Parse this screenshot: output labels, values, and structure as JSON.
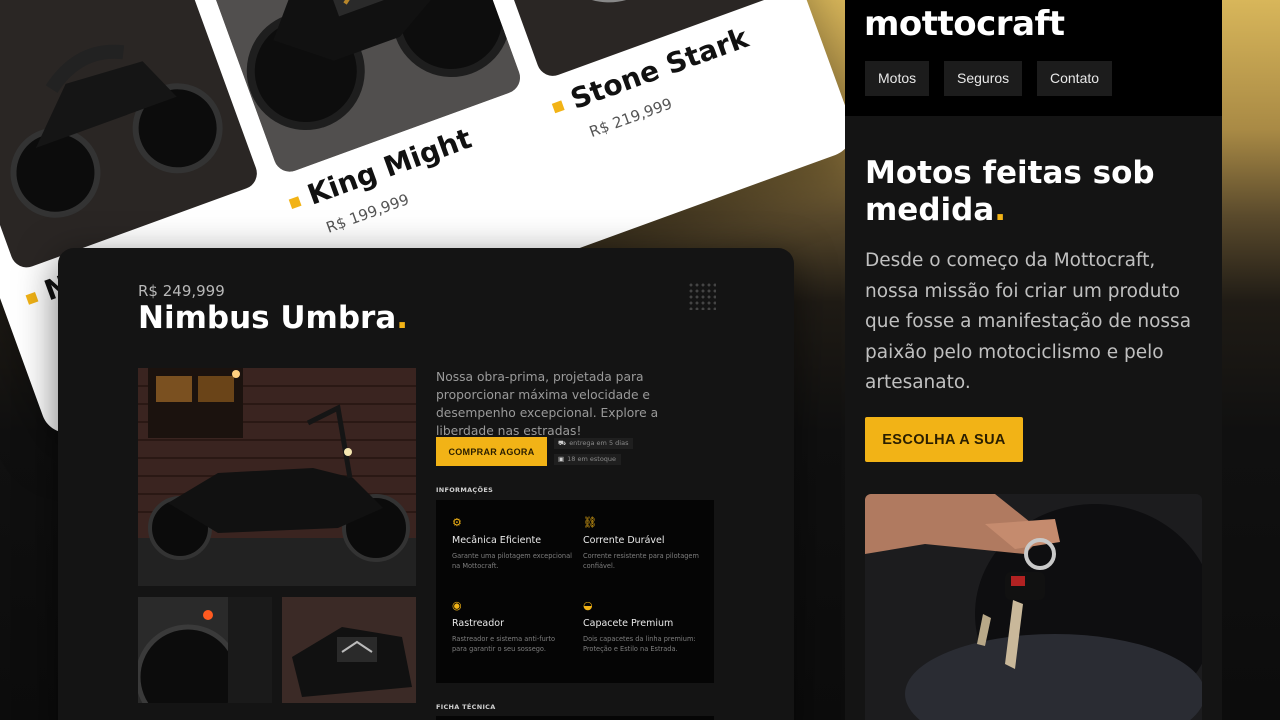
{
  "products": [
    {
      "name": "N",
      "price": ""
    },
    {
      "name": "King Might",
      "price": "R$ 199,999"
    },
    {
      "name": "Stone Stark",
      "price": "R$ 219,999"
    }
  ],
  "detail": {
    "price": "R$ 249,999",
    "title": "Nimbus Umbra",
    "title_dot": ".",
    "description": "Nossa obra-prima, projetada para proporcionar máxima velocidade e desempenho excepcional. Explore a liberdade nas estradas!",
    "buy_label": "COMPRAR AGORA",
    "delivery": "entrega em 5 dias",
    "stock": "18 em estoque",
    "info_label": "INFORMAÇÕES",
    "features": [
      {
        "icon": "gears-icon",
        "glyph": "⚙",
        "title": "Mecânica Eficiente",
        "desc": "Garante uma pilotagem excepcional na Mottocraft."
      },
      {
        "icon": "chain-icon",
        "glyph": "⛓",
        "title": "Corrente Durável",
        "desc": "Corrente resistente para pilotagem confiável."
      },
      {
        "icon": "tracker-icon",
        "glyph": "◉",
        "title": "Rastreador",
        "desc": "Rastreador e sistema anti-furto para garantir o seu sossego."
      },
      {
        "icon": "helmet-icon",
        "glyph": "◒",
        "title": "Capacete Premium",
        "desc": "Dois capacetes da linha premium: Proteção e Estilo na Estrada."
      }
    ],
    "spec_label": "FICHA TÉCNICA"
  },
  "mobile": {
    "logo": "mottocraft",
    "nav": [
      "Motos",
      "Seguros",
      "Contato"
    ],
    "headline": "Motos feitas sob medida",
    "headline_dot": ".",
    "text": "Desde o começo da Mottocraft, nossa missão foi criar um produto que fosse a manifestação de nossa paixão pelo motociclismo e pelo artesanato.",
    "cta": "ESCOLHA A SUA"
  },
  "colors": {
    "accent": "#f2b316",
    "panel": "#141414",
    "header": "#000000"
  }
}
